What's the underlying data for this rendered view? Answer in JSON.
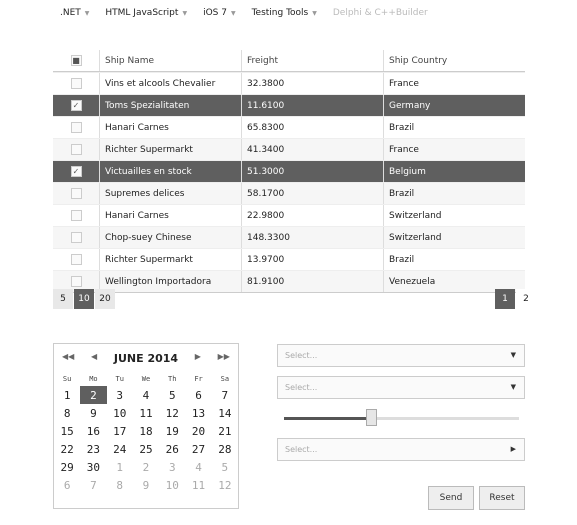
{
  "menu": [
    {
      "label": ".NET",
      "disabled": false
    },
    {
      "label": "HTML JavaScript",
      "disabled": false
    },
    {
      "label": "iOS 7",
      "disabled": false
    },
    {
      "label": "Testing Tools",
      "disabled": false
    },
    {
      "label": "Delphi & C++Builder",
      "disabled": true
    }
  ],
  "grid": {
    "columns": [
      "Ship Name",
      "Freight",
      "Ship Country"
    ],
    "rows": [
      {
        "name": "Vins et alcools Chevalier",
        "freight": "32.3800",
        "country": "France",
        "selected": false
      },
      {
        "name": "Toms Spezialitaten",
        "freight": "11.6100",
        "country": "Germany",
        "selected": true
      },
      {
        "name": "Hanari Carnes",
        "freight": "65.8300",
        "country": "Brazil",
        "selected": false
      },
      {
        "name": "Richter Supermarkt",
        "freight": "41.3400",
        "country": "France",
        "selected": false
      },
      {
        "name": "Victuailles en stock",
        "freight": "51.3000",
        "country": "Belgium",
        "selected": true
      },
      {
        "name": "Supremes delices",
        "freight": "58.1700",
        "country": "Brazil",
        "selected": false
      },
      {
        "name": "Hanari Carnes",
        "freight": "22.9800",
        "country": "Switzerland",
        "selected": false
      },
      {
        "name": "Chop-suey Chinese",
        "freight": "148.3300",
        "country": "Switzerland",
        "selected": false
      },
      {
        "name": "Richter Supermarkt",
        "freight": "13.9700",
        "country": "Brazil",
        "selected": false
      },
      {
        "name": "Wellington Importadora",
        "freight": "81.9100",
        "country": "Venezuela",
        "selected": false
      }
    ]
  },
  "page_sizes": [
    "5",
    "10",
    "20"
  ],
  "active_page_size": "10",
  "pages": [
    "1",
    "2"
  ],
  "active_page": "1",
  "calendar": {
    "title": "JUNE 2014",
    "days": [
      "Su",
      "Mo",
      "Tu",
      "We",
      "Th",
      "Fr",
      "Sa"
    ],
    "selected": "2",
    "weeks": [
      [
        "1",
        "2",
        "3",
        "4",
        "5",
        "6",
        "7"
      ],
      [
        "8",
        "9",
        "10",
        "11",
        "12",
        "13",
        "14"
      ],
      [
        "15",
        "16",
        "17",
        "18",
        "19",
        "20",
        "21"
      ],
      [
        "22",
        "23",
        "24",
        "25",
        "26",
        "27",
        "28"
      ],
      [
        "29",
        "30",
        "1",
        "2",
        "3",
        "4",
        "5"
      ],
      [
        "6",
        "7",
        "8",
        "9",
        "10",
        "11",
        "12"
      ]
    ]
  },
  "dropdowns": [
    "Select...",
    "Select...",
    "Select..."
  ],
  "slider_value": 0.37,
  "buttons": {
    "send": "Send",
    "reset": "Reset"
  }
}
